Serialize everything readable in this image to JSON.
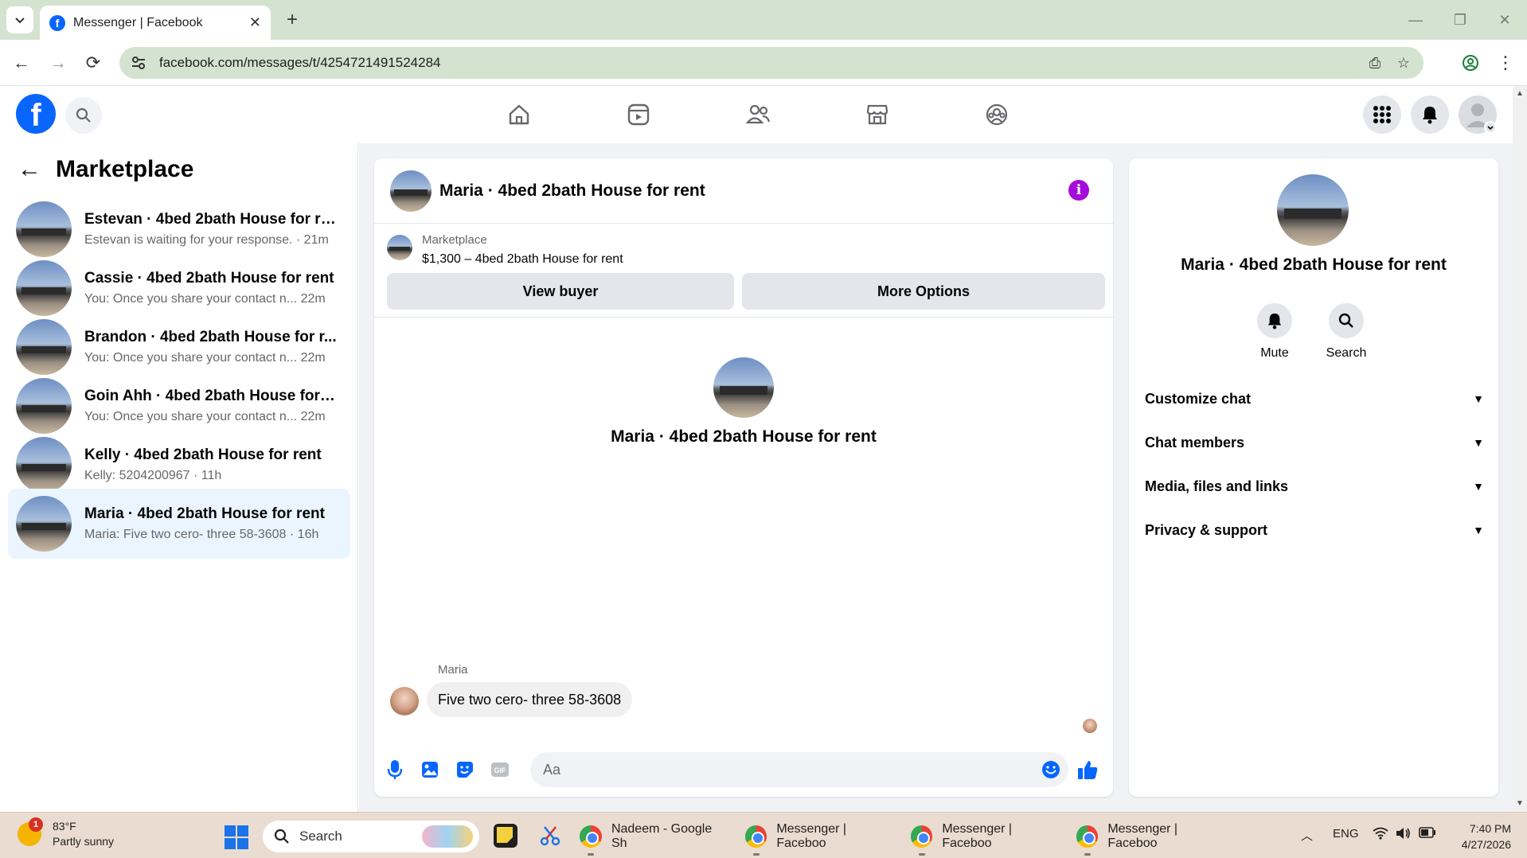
{
  "browser": {
    "tab_title": "Messenger | Facebook",
    "url": "facebook.com/messages/t/4254721491524284"
  },
  "left_panel": {
    "title": "Marketplace",
    "conversations": [
      {
        "name": "Estevan · 4bed 2bath House for rent",
        "preview": "Estevan is waiting for your response. · 21m",
        "active": false
      },
      {
        "name": "Cassie · 4bed 2bath House for rent",
        "preview": "You: Once you share your contact n...  22m",
        "active": false
      },
      {
        "name": "Brandon · 4bed 2bath House for r...",
        "preview": "You: Once you share your contact n...  22m",
        "active": false
      },
      {
        "name": "Goin Ahh · 4bed 2bath House for r...",
        "preview": "You: Once you share your contact n...  22m",
        "active": false
      },
      {
        "name": "Kelly · 4bed 2bath House for rent",
        "preview": "Kelly: 5204200967 · 11h",
        "active": false
      },
      {
        "name": "Maria · 4bed 2bath House for rent",
        "preview": "Maria: Five two cero- three 58-3608 · 16h",
        "active": true
      }
    ]
  },
  "chat": {
    "title": "Maria · 4bed 2bath House for rent",
    "marketplace_label": "Marketplace",
    "listing": "$1,300 – 4bed 2bath House for rent",
    "view_buyer": "View buyer",
    "more_options": "More Options",
    "center_name": "Maria · 4bed 2bath House for rent",
    "sender": "Maria",
    "message": "Five two cero- three 58-3608",
    "input_placeholder": "Aa"
  },
  "right_panel": {
    "name": "Maria · 4bed 2bath House for rent",
    "mute": "Mute",
    "search": "Search",
    "sections": [
      "Customize chat",
      "Chat members",
      "Media, files and links",
      "Privacy & support"
    ]
  },
  "taskbar": {
    "temp": "83°F",
    "condition": "Partly sunny",
    "weather_badge": "1",
    "search": "Search",
    "tasks": [
      "Nadeem - Google Sh",
      "Messenger | Faceboo",
      "Messenger | Faceboo",
      "Messenger | Faceboo"
    ],
    "lang": "ENG",
    "time": "7:40 PM",
    "date": "4/27/2026"
  },
  "colors": {
    "fb_blue": "#0866ff",
    "info_purple": "#a40bdb",
    "active_row": "#ebf5ff"
  }
}
